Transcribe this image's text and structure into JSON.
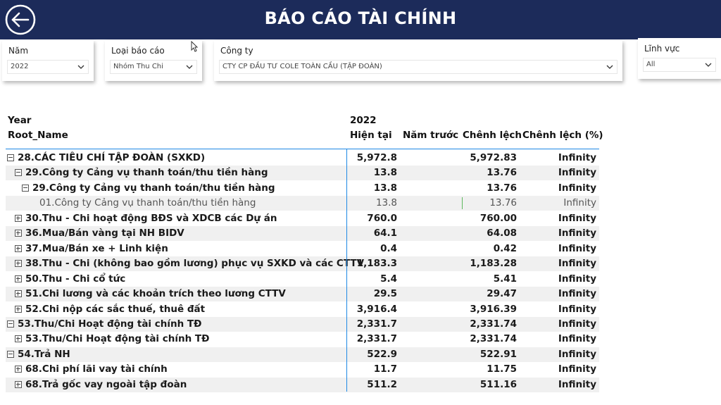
{
  "header": {
    "title": "BÁO CÁO TÀI CHÍNH"
  },
  "filters": [
    {
      "label": "Năm",
      "value": "2022"
    },
    {
      "label": "Loại báo cáo",
      "value": "Nhóm Thu Chi"
    },
    {
      "label": "Công ty",
      "value": "CTY CP ĐẦU TƯ COLE TOÀN CẦU (TẬP ĐOÀN)"
    },
    {
      "label": "Lĩnh vực",
      "value": "All"
    }
  ],
  "table": {
    "row_header_1": "Year",
    "row_header_2": "Root_Name",
    "year": "2022",
    "columns": [
      "Hiện tại",
      "Năm trước",
      "Chênh lệch",
      "Chênh lệch (%)"
    ],
    "rows": [
      {
        "name": "28.CÁC TIÊU CHÍ TẬP ĐOÀN (SXKD)",
        "level": 0,
        "toggle": "minus",
        "current": "5,972.8",
        "previous": "",
        "diff": "5,972.83",
        "pct": "Infinity"
      },
      {
        "name": "29.Công ty Cảng vụ thanh toán/thu tiền hàng",
        "level": 1,
        "toggle": "minus",
        "current": "13.8",
        "previous": "",
        "diff": "13.76",
        "pct": "Infinity"
      },
      {
        "name": "29.Công ty Cảng vụ thanh toán/thu tiền hàng",
        "level": 2,
        "toggle": "minus",
        "current": "13.8",
        "previous": "",
        "diff": "13.76",
        "pct": "Infinity"
      },
      {
        "name": "01.Công ty Cảng vụ thanh toán/thu tiền hàng",
        "level": 3,
        "toggle": "none",
        "current": "13.8",
        "previous": "",
        "diff": "13.76",
        "pct": "Infinity"
      },
      {
        "name": "30.Thu - Chi hoạt động BĐS và XDCB các Dự án",
        "level": 1,
        "toggle": "plus",
        "current": "760.0",
        "previous": "",
        "diff": "760.00",
        "pct": "Infinity"
      },
      {
        "name": "36.Mua/Bán vàng tại NH BIDV",
        "level": 1,
        "toggle": "plus",
        "current": "64.1",
        "previous": "",
        "diff": "64.08",
        "pct": "Infinity"
      },
      {
        "name": "37.Mua/Bán xe + Linh kiện",
        "level": 1,
        "toggle": "plus",
        "current": "0.4",
        "previous": "",
        "diff": "0.42",
        "pct": "Infinity"
      },
      {
        "name": "38.Thu - Chi (không bao gồm lương) phục vụ SXKD và các CTTV",
        "level": 1,
        "toggle": "plus",
        "current": "1,183.3",
        "previous": "",
        "diff": "1,183.28",
        "pct": "Infinity"
      },
      {
        "name": "50.Thu - Chi cổ tức",
        "level": 1,
        "toggle": "plus",
        "current": "5.4",
        "previous": "",
        "diff": "5.41",
        "pct": "Infinity"
      },
      {
        "name": "51.Chi lương và các khoản trích theo lương CTTV",
        "level": 1,
        "toggle": "plus",
        "current": "29.5",
        "previous": "",
        "diff": "29.47",
        "pct": "Infinity"
      },
      {
        "name": "52.Chi nộp các sắc thuế, thuê đất",
        "level": 1,
        "toggle": "plus",
        "current": "3,916.4",
        "previous": "",
        "diff": "3,916.39",
        "pct": "Infinity"
      },
      {
        "name": "53.Thu/Chi Hoạt động tài chính TĐ",
        "level": 0,
        "toggle": "minus",
        "current": "2,331.7",
        "previous": "",
        "diff": "2,331.74",
        "pct": "Infinity"
      },
      {
        "name": "53.Thu/Chi Hoạt động tài chính TĐ",
        "level": 1,
        "toggle": "plus",
        "current": "2,331.7",
        "previous": "",
        "diff": "2,331.74",
        "pct": "Infinity"
      },
      {
        "name": "54.Trả NH",
        "level": 0,
        "toggle": "minus",
        "current": "522.9",
        "previous": "",
        "diff": "522.91",
        "pct": "Infinity"
      },
      {
        "name": "68.Chi phí lãi vay tài chính",
        "level": 1,
        "toggle": "plus",
        "current": "11.7",
        "previous": "",
        "diff": "11.75",
        "pct": "Infinity"
      },
      {
        "name": "68.Trả gốc vay ngoài tập đoàn",
        "level": 1,
        "toggle": "plus",
        "current": "511.2",
        "previous": "",
        "diff": "511.16",
        "pct": "Infinity"
      }
    ]
  }
}
